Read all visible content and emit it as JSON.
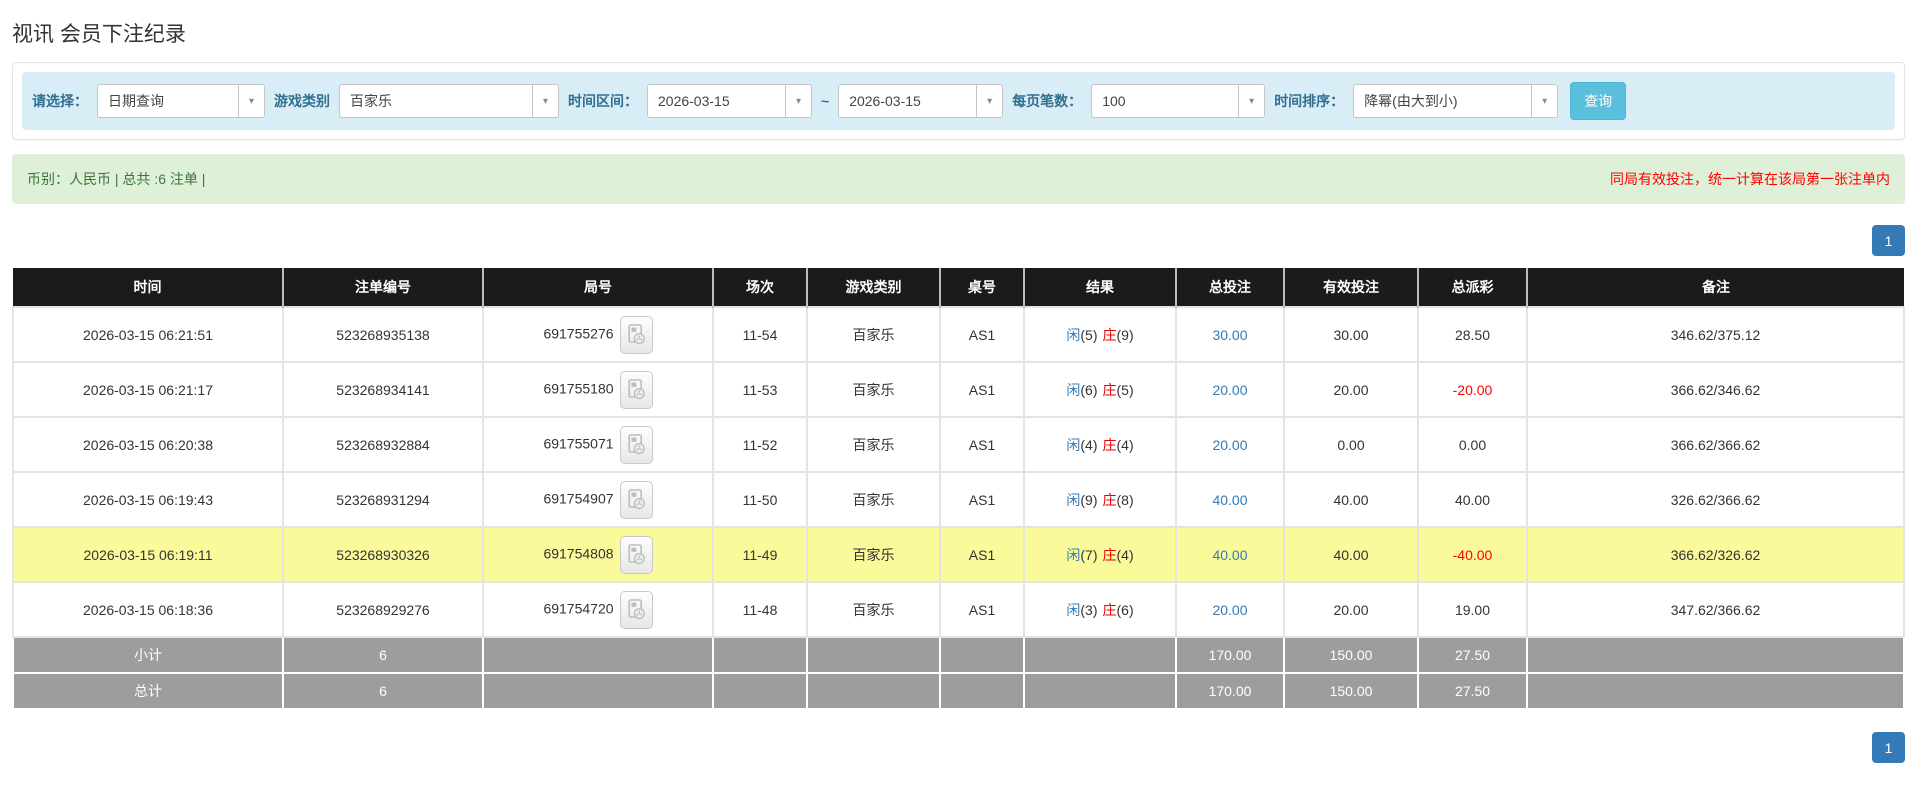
{
  "page": {
    "title": "视讯 会员下注纪录"
  },
  "filters": {
    "select_label": "请选择：",
    "select_value": "日期查询",
    "game_label": "游戏类别",
    "game_value": "百家乐",
    "range_label": "时间区间：",
    "range_from": "2026-03-15",
    "range_separator": "~",
    "range_to": "2026-03-15",
    "page_size_label": "每页笔数：",
    "page_size_value": "100",
    "sort_label": "时间排序：",
    "sort_value": "降幂(由大到小)",
    "search_button": "查询",
    "dropdown_caret": "▾"
  },
  "summary_bar": {
    "left_text": "币别：人民币 | 总共 :6 注单 |",
    "right_notice": "同局有效投注，统一计算在该局第一张注单内"
  },
  "pagination": {
    "page": "1"
  },
  "table": {
    "headers": [
      {
        "key": "time",
        "label": "时间"
      },
      {
        "key": "bet-no",
        "label": "注单编号"
      },
      {
        "key": "round-no",
        "label": "局号"
      },
      {
        "key": "session",
        "label": "场次"
      },
      {
        "key": "game-type",
        "label": "游戏类别"
      },
      {
        "key": "table-no",
        "label": "桌号"
      },
      {
        "key": "result",
        "label": "结果"
      },
      {
        "key": "total-bet",
        "label": "总投注"
      },
      {
        "key": "valid-bet",
        "label": "有效投注"
      },
      {
        "key": "total-payout",
        "label": "总派彩"
      },
      {
        "key": "note",
        "label": "备注"
      }
    ],
    "result_labels": {
      "player": "闲",
      "banker": "庄"
    },
    "rows": [
      {
        "time": "2026-03-15 06:21:51",
        "bet_no": "523268935138",
        "round_no": "691755276",
        "session": "11-54",
        "game": "百家乐",
        "table_no": "AS1",
        "player": "(5)",
        "banker": "(9)",
        "total_bet": "30.00",
        "valid_bet": "30.00",
        "payout": "28.50",
        "note": "346.62/375.12",
        "highlighted": false
      },
      {
        "time": "2026-03-15 06:21:17",
        "bet_no": "523268934141",
        "round_no": "691755180",
        "session": "11-53",
        "game": "百家乐",
        "table_no": "AS1",
        "player": "(6)",
        "banker": "(5)",
        "total_bet": "20.00",
        "valid_bet": "20.00",
        "payout": "-20.00",
        "note": "366.62/346.62",
        "highlighted": false
      },
      {
        "time": "2026-03-15 06:20:38",
        "bet_no": "523268932884",
        "round_no": "691755071",
        "session": "11-52",
        "game": "百家乐",
        "table_no": "AS1",
        "player": "(4)",
        "banker": "(4)",
        "total_bet": "20.00",
        "valid_bet": "0.00",
        "payout": "0.00",
        "note": "366.62/366.62",
        "highlighted": false
      },
      {
        "time": "2026-03-15 06:19:43",
        "bet_no": "523268931294",
        "round_no": "691754907",
        "session": "11-50",
        "game": "百家乐",
        "table_no": "AS1",
        "player": "(9)",
        "banker": "(8)",
        "total_bet": "40.00",
        "valid_bet": "40.00",
        "payout": "40.00",
        "note": "326.62/366.62",
        "highlighted": false
      },
      {
        "time": "2026-03-15 06:19:11",
        "bet_no": "523268930326",
        "round_no": "691754808",
        "session": "11-49",
        "game": "百家乐",
        "table_no": "AS1",
        "player": "(7)",
        "banker": "(4)",
        "total_bet": "40.00",
        "valid_bet": "40.00",
        "payout": "-40.00",
        "note": "366.62/326.62",
        "highlighted": true
      },
      {
        "time": "2026-03-15 06:18:36",
        "bet_no": "523268929276",
        "round_no": "691754720",
        "session": "11-48",
        "game": "百家乐",
        "table_no": "AS1",
        "player": "(3)",
        "banker": "(6)",
        "total_bet": "20.00",
        "valid_bet": "20.00",
        "payout": "19.00",
        "note": "347.62/366.62",
        "highlighted": false
      }
    ],
    "summary_rows": [
      {
        "label": "小计",
        "count": "6",
        "total_bet": "170.00",
        "valid_bet": "150.00",
        "payout": "27.50"
      },
      {
        "label": "总计",
        "count": "6",
        "total_bet": "170.00",
        "valid_bet": "150.00",
        "payout": "27.50"
      }
    ]
  },
  "colors": {
    "accent_blue": "#337ab7",
    "search_button_bg": "#5bc0de",
    "filter_bar_bg": "#d9edf7",
    "filter_label_text": "#31708f",
    "info_bar_bg": "#dff0d8",
    "info_text_green": "#3c763d",
    "notice_red": "#ff0000",
    "header_bg": "#1b1b1b",
    "summary_row_bg": "#9d9d9d",
    "highlight_row_bg": "#fafa9b",
    "player_blue": "#337ab7",
    "banker_red": "#e60000"
  }
}
